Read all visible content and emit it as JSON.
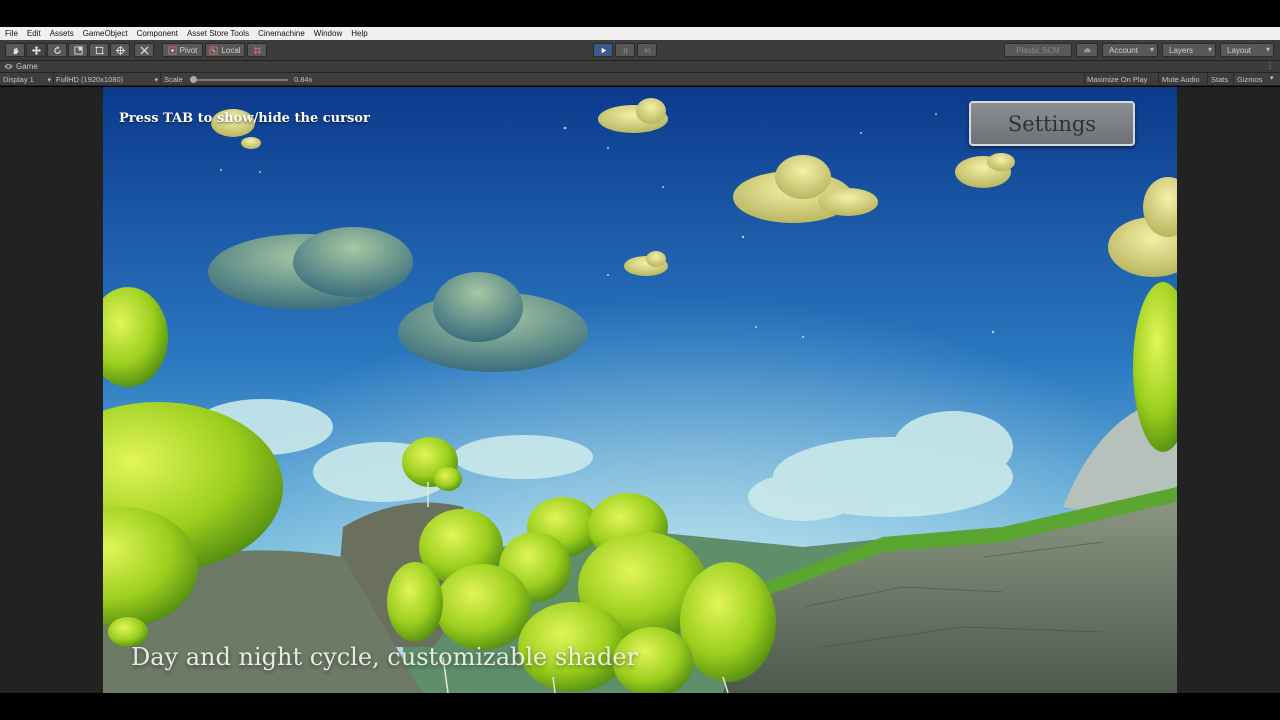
{
  "menu": [
    "File",
    "Edit",
    "Assets",
    "GameObject",
    "Component",
    "Asset Store Tools",
    "Cinemachine",
    "Window",
    "Help"
  ],
  "toolbar": {
    "pivot_label": "Pivot",
    "local_label": "Local",
    "plastic_label": "Plastic SCM",
    "account_label": "Account",
    "layers_label": "Layers",
    "layout_label": "Layout"
  },
  "game_tab": {
    "label": "Game"
  },
  "game_bar": {
    "display": "Display 1",
    "resolution": "FullHD (1920x1080)",
    "scale_label": "Scale",
    "scale_value": "0.84x",
    "maximize_on_play": "Maximize On Play",
    "mute_audio": "Mute Audio",
    "stats": "Stats",
    "gizmos": "Gizmos"
  },
  "game_view": {
    "hint": "Press TAB to show/hide the cursor",
    "settings_button": "Settings",
    "caption": "Day and night cycle, customizable shader"
  },
  "icons": [
    "hand-icon",
    "move-icon",
    "rotate-icon",
    "scale-icon",
    "rect-icon",
    "transform-icon",
    "custom-tool-icon",
    "pivot-icon",
    "local-icon",
    "grid-snap-icon",
    "play-icon",
    "pause-icon",
    "step-icon",
    "cloud-icon",
    "kebab-icon",
    "eye-icon"
  ],
  "colors": {
    "editor_bg": "#3c3c3c",
    "play_active": "#3a5a8a",
    "sky_top": "#0c3a8c",
    "sky_horizon": "#8fcbe6"
  }
}
